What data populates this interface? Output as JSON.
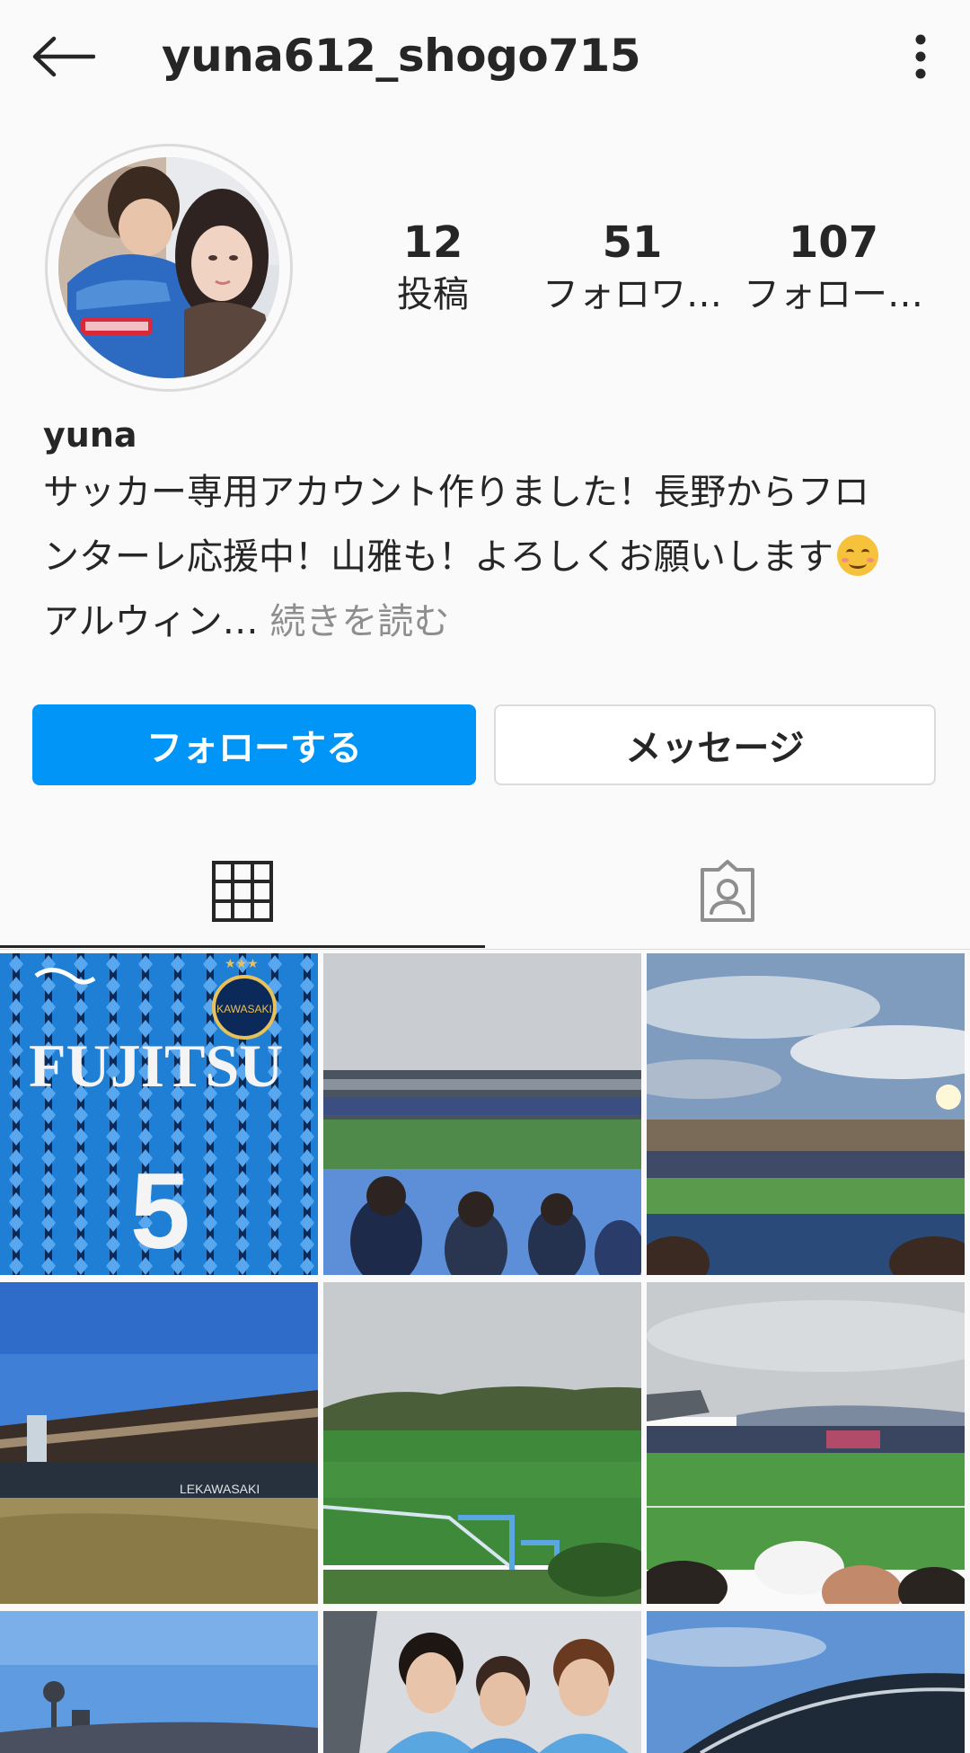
{
  "header": {
    "username": "yuna612_shogo715",
    "back_icon": "back-arrow-icon",
    "more_icon": "vertical-dots-icon"
  },
  "profile": {
    "avatar_desc": "profile-photo",
    "stats": [
      {
        "value": "12",
        "label": "投稿"
      },
      {
        "value": "51",
        "label": "フォロワ…"
      },
      {
        "value": "107",
        "label": "フォロー…"
      }
    ],
    "display_name": "yuna",
    "bio_lines": [
      "サッカー専用アカウント作りました！長野からフロ",
      "ンターレ応援中！山雅も！よろしくお願いします"
    ],
    "bio_line3": "アルウィン…",
    "read_more": "続きを読む"
  },
  "actions": {
    "follow_label": "フォローする",
    "message_label": "メッセージ"
  },
  "tabs": {
    "grid_icon": "grid-icon",
    "tagged_icon": "tagged-user-icon"
  },
  "posts": {
    "tile1_text": "FUJITSU",
    "tile1_number": "5",
    "tile4_text": "LEKAWASAKI"
  },
  "colors": {
    "accent": "#0095f6",
    "text": "#262626",
    "muted": "#8e8e8e",
    "border": "#dbdbdb"
  }
}
